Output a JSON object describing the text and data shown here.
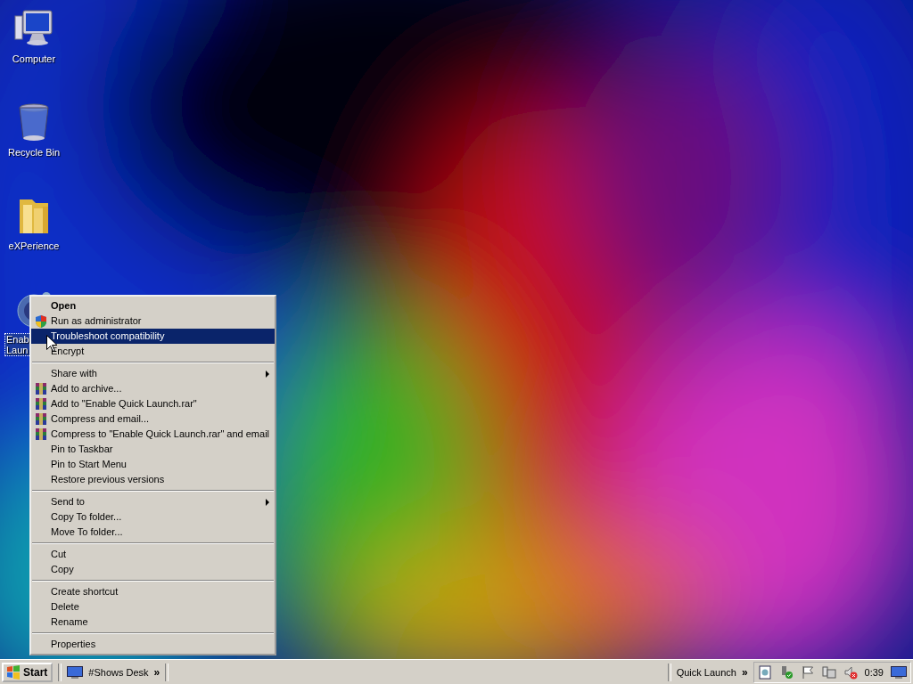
{
  "desktop_icons": [
    {
      "kind": "computer",
      "label_lines": [
        "Computer"
      ],
      "selected": false
    },
    {
      "kind": "recycle-bin",
      "label_lines": [
        "Recycle Bin"
      ],
      "selected": false
    },
    {
      "kind": "folder",
      "label_lines": [
        "eXPerience"
      ],
      "selected": false
    },
    {
      "kind": "shortcut",
      "label_lines": [
        "Enab",
        "Laun"
      ],
      "selected": true
    }
  ],
  "context_menu": {
    "items": [
      {
        "kind": "default",
        "label": "Open",
        "selected": false
      },
      {
        "kind": "shield",
        "label": "Run as administrator",
        "selected": false
      },
      {
        "kind": "item",
        "label": "Troubleshoot compatibility",
        "selected": true
      },
      {
        "kind": "item",
        "label": "Encrypt",
        "selected": false
      },
      {
        "kind": "separator"
      },
      {
        "kind": "submenu",
        "label": "Share with",
        "selected": false
      },
      {
        "kind": "archive",
        "label": "Add to archive...",
        "selected": false
      },
      {
        "kind": "archive",
        "label": "Add to \"Enable Quick Launch.rar\"",
        "selected": false
      },
      {
        "kind": "archive",
        "label": "Compress and email...",
        "selected": false
      },
      {
        "kind": "archive",
        "label": "Compress to \"Enable Quick Launch.rar\" and email",
        "selected": false
      },
      {
        "kind": "item",
        "label": "Pin to Taskbar",
        "selected": false
      },
      {
        "kind": "item",
        "label": "Pin to Start Menu",
        "selected": false
      },
      {
        "kind": "item",
        "label": "Restore previous versions",
        "selected": false
      },
      {
        "kind": "separator"
      },
      {
        "kind": "submenu",
        "label": "Send to",
        "selected": false
      },
      {
        "kind": "item",
        "label": "Copy To folder...",
        "selected": false
      },
      {
        "kind": "item",
        "label": "Move To folder...",
        "selected": false
      },
      {
        "kind": "separator"
      },
      {
        "kind": "item",
        "label": "Cut",
        "selected": false
      },
      {
        "kind": "item",
        "label": "Copy",
        "selected": false
      },
      {
        "kind": "separator"
      },
      {
        "kind": "item",
        "label": "Create shortcut",
        "selected": false
      },
      {
        "kind": "item",
        "label": "Delete",
        "selected": false
      },
      {
        "kind": "item",
        "label": "Rename",
        "selected": false
      },
      {
        "kind": "separator"
      },
      {
        "kind": "item",
        "label": "Properties",
        "selected": false
      }
    ]
  },
  "taskbar": {
    "start_button": "Start",
    "toolbar": {
      "label": "#Shows Desk",
      "chevron": "»"
    },
    "quick_launch": {
      "label": "Quick Launch",
      "chevron": "»"
    },
    "clock": "0:39"
  }
}
